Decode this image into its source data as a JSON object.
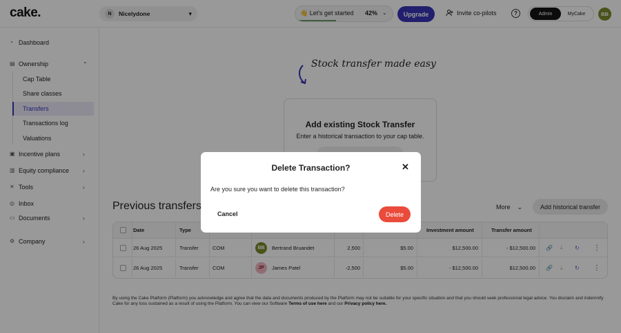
{
  "header": {
    "logo": "cake.",
    "company": {
      "initial": "N",
      "name": "Nicelydone"
    },
    "get_started": {
      "label": "👋 Let's get started",
      "progress_text": "42%",
      "progress": 0.42
    },
    "upgrade_label": "Upgrade",
    "invite_label": "Invite co-pilots",
    "mode_options": [
      "Admin",
      "MyCake"
    ],
    "mode_selected": "Admin",
    "user_initials": "BB"
  },
  "sidebar": {
    "items": [
      {
        "label": "Dashboard",
        "icon": "gauge-icon"
      },
      {
        "label": "Ownership",
        "icon": "pie-icon",
        "expanded": true
      },
      {
        "label": "Incentive plans",
        "icon": "gift-icon"
      },
      {
        "label": "Equity compliance",
        "icon": "doc-icon"
      },
      {
        "label": "Tools",
        "icon": "tools-icon"
      },
      {
        "label": "Inbox",
        "icon": "inbox-icon"
      },
      {
        "label": "Documents",
        "icon": "folder-icon"
      },
      {
        "label": "Company",
        "icon": "gear-icon"
      }
    ],
    "ownership_sub": [
      "Cap Table",
      "Share classes",
      "Transfers",
      "Transactions log",
      "Valuations"
    ],
    "active_sub": "Transfers"
  },
  "main": {
    "handwritten": "Stock transfer made easy",
    "add_card": {
      "title": "Add existing Stock Transfer",
      "subtitle": "Enter a historical transaction to your cap table."
    },
    "section_title": "Previous transfers",
    "more_label": "More",
    "add_button": "Add historical transfer",
    "table": {
      "headers": [
        "Date",
        "Type",
        "",
        "",
        "",
        "",
        "Investment amount",
        "Transfer amount"
      ],
      "rows": [
        {
          "date": "26 Aug 2025",
          "type": "Transfer",
          "class": "COM",
          "initials": "BB",
          "name": "Bertrand Bruandet",
          "shares": "2,500",
          "price": "$5.00",
          "investment": "$12,500.00",
          "transfer": "- $12,500.00",
          "avatar_color": "#7b8a2c",
          "avatar_text": "#ffffff"
        },
        {
          "date": "26 Aug 2025",
          "type": "Transfer",
          "class": "COM",
          "initials": "JP",
          "name": "James Patel",
          "shares": "-2,500",
          "price": "$5.00",
          "investment": "- $12,500.00",
          "transfer": "$12,500.00",
          "avatar_color": "#f0b6c0",
          "avatar_text": "#8a1f36"
        }
      ]
    },
    "footer": {
      "text": "By using the Cake Platform (Platform) you acknowledge and agree that the data and documents produced by the Platform may not be suitable for your specific situation and that you should seek professional legal advice. You disclaim and indemnify Cake for any loss sustained as a result of using the Platform. You can view our Software",
      "terms_link": "Terms of use here",
      "and_our": "and our",
      "privacy_link": "Privacy policy here."
    }
  },
  "modal": {
    "title": "Delete Transaction?",
    "message": "Are you sure you want to delete this transaction?",
    "cancel_label": "Cancel",
    "delete_label": "Delete"
  },
  "colors": {
    "brand": "#3a35b8",
    "danger": "#ea4b3b"
  }
}
